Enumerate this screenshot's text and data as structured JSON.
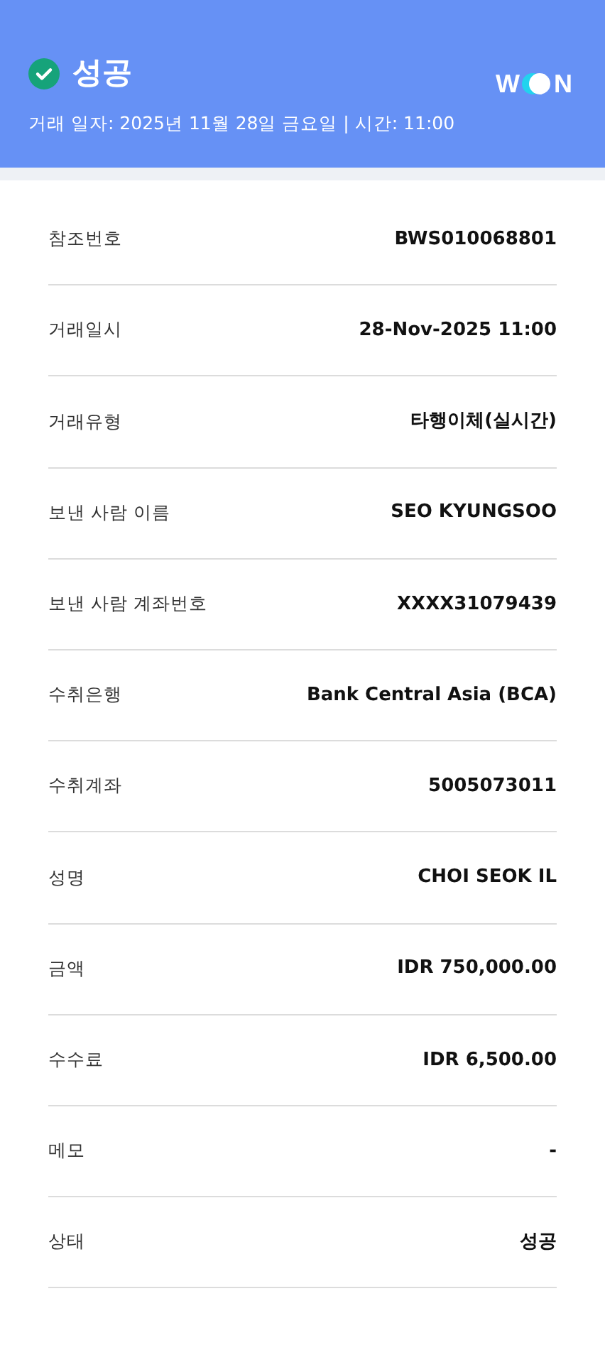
{
  "header": {
    "status": {
      "kind": "success",
      "label": "성공"
    },
    "subtitle": "거래 일자: 2025년 11월 28일 금요일 | 시간: 11:00",
    "logo": {
      "left": "W",
      "right": "N"
    }
  },
  "details": [
    {
      "label": "참조번호",
      "value": "BWS010068801"
    },
    {
      "label": "거래일시",
      "value": "28-Nov-2025 11:00"
    },
    {
      "label": "거래유형",
      "value": "타행이체(실시간)"
    },
    {
      "label": "보낸 사람 이름",
      "value": "SEO KYUNGSOO"
    },
    {
      "label": "보낸 사람 계좌번호",
      "value": "XXXX31079439"
    },
    {
      "label": "수취은행",
      "value": "Bank Central Asia (BCA)"
    },
    {
      "label": "수취계좌",
      "value": "5005073011"
    },
    {
      "label": "성명",
      "value": "CHOI SEOK IL"
    },
    {
      "label": "금액",
      "value": "IDR 750,000.00"
    },
    {
      "label": "수수료",
      "value": "IDR 6,500.00"
    },
    {
      "label": "메모",
      "value": "-"
    },
    {
      "label": "상태",
      "value": "성공"
    }
  ]
}
